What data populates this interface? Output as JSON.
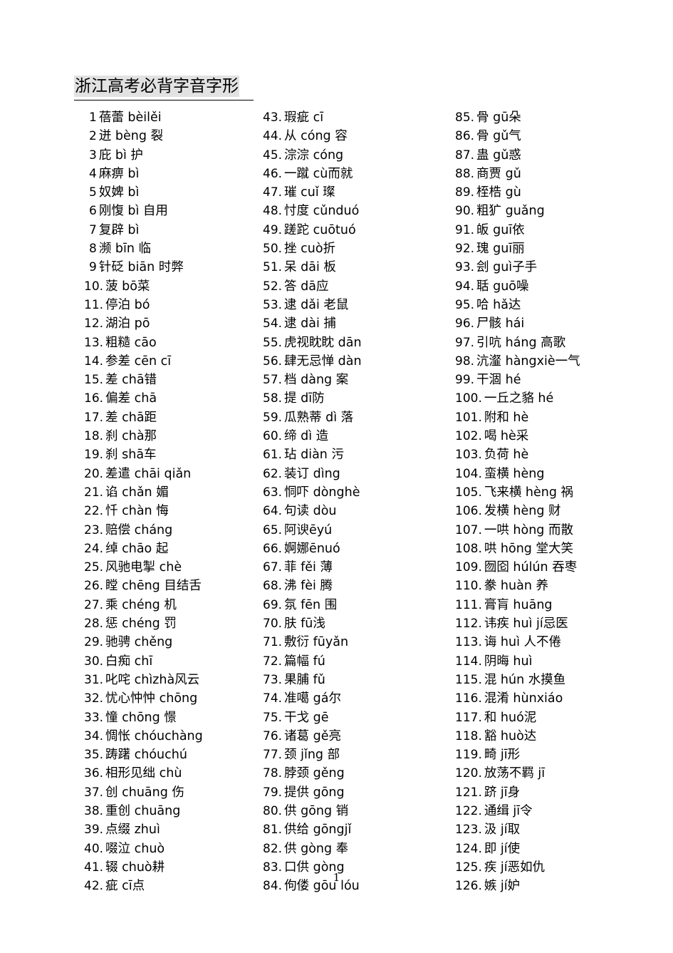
{
  "document": {
    "title": "浙江高考必背字音字形",
    "page_number": "1",
    "title_highlight_color": "#e2e2e2",
    "text_color": "#000000",
    "background_color": "#ffffff"
  },
  "columns": [
    {
      "id": "column-1",
      "entries": [
        {
          "num": "1",
          "text": "蓓蕾 bèilěi"
        },
        {
          "num": "2",
          "text": "迸 bèng 裂"
        },
        {
          "num": "3",
          "text": "庇 bì 护"
        },
        {
          "num": "4",
          "text": "麻痹 bì"
        },
        {
          "num": "5",
          "text": "奴婢 bì"
        },
        {
          "num": "6",
          "text": "刚愎 bì 自用"
        },
        {
          "num": "7",
          "text": "复辟 bì"
        },
        {
          "num": "8",
          "text": "濒 bīn 临"
        },
        {
          "num": "9",
          "text": "针砭 biān 时弊"
        },
        {
          "num": "10.",
          "text": "菠 bō菜"
        },
        {
          "num": "11.",
          "text": "停泊 bó"
        },
        {
          "num": "12.",
          "text": "湖泊 pō"
        },
        {
          "num": "13.",
          "text": "粗糙 cāo"
        },
        {
          "num": "14.",
          "text": "参差 cēn cī"
        },
        {
          "num": "15.",
          "text": "差 chā错"
        },
        {
          "num": "16.",
          "text": "偏差 chā"
        },
        {
          "num": "17.",
          "text": "差 chā距"
        },
        {
          "num": "18.",
          "text": "刹 chà那"
        },
        {
          "num": "19.",
          "text": "刹 shā车"
        },
        {
          "num": "20.",
          "text": "差遣 chāi qiǎn"
        },
        {
          "num": "21.",
          "text": "谄 chǎn 媚"
        },
        {
          "num": "22.",
          "text": "忏 chàn 悔"
        },
        {
          "num": "23.",
          "text": "赔偿 cháng"
        },
        {
          "num": "24.",
          "text": "绰 chāo 起"
        },
        {
          "num": "25.",
          "text": "风驰电掣 chè"
        },
        {
          "num": "26.",
          "text": "瞠 chēng 目结舌"
        },
        {
          "num": "27.",
          "text": "乘 chéng 机"
        },
        {
          "num": "28.",
          "text": "惩 chéng 罚"
        },
        {
          "num": "29.",
          "text": "驰骋 chěng"
        },
        {
          "num": "30.",
          "text": "白痴 chī"
        },
        {
          "num": "31.",
          "text": "叱咤 chìzhà风云"
        },
        {
          "num": "32.",
          "text": "忧心忡忡 chōng"
        },
        {
          "num": "33.",
          "text": "憧 chōng 憬"
        },
        {
          "num": "34.",
          "text": "惆怅 chóuchàng"
        },
        {
          "num": "35.",
          "text": "踌躇 chóuchú"
        },
        {
          "num": "36.",
          "text": "相形见绌 chù"
        },
        {
          "num": "37.",
          "text": "创 chuāng 伤"
        },
        {
          "num": "38.",
          "text": "重创 chuāng"
        },
        {
          "num": "39.",
          "text": "点缀 zhuì"
        },
        {
          "num": "40.",
          "text": "啜泣 chuò"
        },
        {
          "num": "41.",
          "text": "辍 chuò耕"
        },
        {
          "num": "42.",
          "text": "疵 cī点"
        }
      ]
    },
    {
      "id": "column-2",
      "entries": [
        {
          "num": "43.",
          "text": "瑕疵 cī"
        },
        {
          "num": "44.",
          "text": "从 cóng 容"
        },
        {
          "num": "45.",
          "text": "淙淙 cóng"
        },
        {
          "num": "46.",
          "text": "一蹴 cù而就"
        },
        {
          "num": "47.",
          "text": "璀 cuǐ 璨"
        },
        {
          "num": "48.",
          "text": "忖度 cǔnduó"
        },
        {
          "num": "49.",
          "text": "蹉跎 cuōtuó"
        },
        {
          "num": "50.",
          "text": "挫 cuò折"
        },
        {
          "num": "51.",
          "text": "呆 dāi 板"
        },
        {
          "num": "52.",
          "text": "答 dā应"
        },
        {
          "num": "53.",
          "text": "逮 dǎi 老鼠"
        },
        {
          "num": "54.",
          "text": "逮 dài 捕"
        },
        {
          "num": "55.",
          "text": "虎视眈眈 dān"
        },
        {
          "num": "56.",
          "text": "肆无忌惮 dàn"
        },
        {
          "num": "57.",
          "text": "档 dàng 案"
        },
        {
          "num": "58.",
          "text": "提 dī防"
        },
        {
          "num": "59.",
          "text": "瓜熟蒂 dì 落"
        },
        {
          "num": "60.",
          "text": "缔 dì 造"
        },
        {
          "num": "61.",
          "text": "玷 diàn 污"
        },
        {
          "num": "62.",
          "text": "装订 dìng"
        },
        {
          "num": "63.",
          "text": "恫吓 dònghè"
        },
        {
          "num": "64.",
          "text": "句读 dòu"
        },
        {
          "num": "65.",
          "text": "阿谀ēyú"
        },
        {
          "num": "66.",
          "text": "婀娜ēnuó"
        },
        {
          "num": "67.",
          "text": "菲 fěi 薄"
        },
        {
          "num": "68.",
          "text": "沸 fèi 腾"
        },
        {
          "num": "69.",
          "text": "氛 fēn 围"
        },
        {
          "num": "70.",
          "text": "肤 fū浅"
        },
        {
          "num": "71.",
          "text": "敷衍 fūyǎn"
        },
        {
          "num": "72.",
          "text": "篇幅 fú"
        },
        {
          "num": "73.",
          "text": "果脯 fǔ"
        },
        {
          "num": "74.",
          "text": "准噶 gá尔"
        },
        {
          "num": "75.",
          "text": "干戈 gē"
        },
        {
          "num": "76.",
          "text": "诸葛 gě亮"
        },
        {
          "num": "77.",
          "text": "颈 jǐng 部"
        },
        {
          "num": "78.",
          "text": "脖颈 gěng"
        },
        {
          "num": "79.",
          "text": "提供 gōng"
        },
        {
          "num": "80.",
          "text": "供 gōng 销"
        },
        {
          "num": "81.",
          "text": "供给 gōngjǐ"
        },
        {
          "num": "82.",
          "text": "供 gòng 奉"
        },
        {
          "num": "83.",
          "text": "口供 gòng"
        },
        {
          "num": "84.",
          "text": "佝偻 gōu lóu"
        }
      ]
    },
    {
      "id": "column-3",
      "entries": [
        {
          "num": "85.",
          "text": "骨 gū朵"
        },
        {
          "num": "86.",
          "text": "骨 gǔ气"
        },
        {
          "num": "87.",
          "text": "蛊 gǔ惑"
        },
        {
          "num": "88.",
          "text": "商贾 gǔ"
        },
        {
          "num": "89.",
          "text": "桎梏 gù"
        },
        {
          "num": "90.",
          "text": "粗犷 guǎng"
        },
        {
          "num": "91.",
          "text": "皈 guī依"
        },
        {
          "num": "92.",
          "text": "瑰 guī丽"
        },
        {
          "num": "93.",
          "text": "刽 guì子手"
        },
        {
          "num": "94.",
          "text": "聒 guō噪"
        },
        {
          "num": "95.",
          "text": "哈 hǎ达"
        },
        {
          "num": "96.",
          "text": "尸骸 hái"
        },
        {
          "num": "97.",
          "text": "引吭 háng 高歌"
        },
        {
          "num": "98.",
          "text": "沆瀣 hàngxiè一气"
        },
        {
          "num": "99.",
          "text": "干涸 hé"
        },
        {
          "num": "100.",
          "text": "一丘之貉 hé"
        },
        {
          "num": "101.",
          "text": "附和 hè"
        },
        {
          "num": "102.",
          "text": "喝 hè采"
        },
        {
          "num": "103.",
          "text": "负荷 hè"
        },
        {
          "num": "104.",
          "text": "蛮横 hèng"
        },
        {
          "num": "105.",
          "text": "飞来横 hèng 祸"
        },
        {
          "num": "106.",
          "text": "发横 hèng 财"
        },
        {
          "num": "107.",
          "text": "一哄 hòng 而散"
        },
        {
          "num": "108.",
          "text": "哄 hōng 堂大笑"
        },
        {
          "num": "109.",
          "text": "囫囵 húlún 吞枣"
        },
        {
          "num": "110.",
          "text": "豢 huàn 养"
        },
        {
          "num": "111.",
          "text": "膏肓 huāng"
        },
        {
          "num": "112.",
          "text": "讳疾 huì jí忌医"
        },
        {
          "num": "113.",
          "text": "诲 huì 人不倦"
        },
        {
          "num": "114.",
          "text": "阴晦 huì"
        },
        {
          "num": "115.",
          "text": "混 hún 水摸鱼"
        },
        {
          "num": "116.",
          "text": "混淆 hùnxiáo"
        },
        {
          "num": "117.",
          "text": "和 huó泥"
        },
        {
          "num": "118.",
          "text": "豁 huò达"
        },
        {
          "num": "119.",
          "text": "畸 jī形"
        },
        {
          "num": "120.",
          "text": "放荡不羁 jī"
        },
        {
          "num": "121.",
          "text": "跻 jī身"
        },
        {
          "num": "122.",
          "text": "通缉 jī令"
        },
        {
          "num": "123.",
          "text": "汲 jí取"
        },
        {
          "num": "124.",
          "text": "即 jí使"
        },
        {
          "num": "125.",
          "text": "疾 jí恶如仇"
        },
        {
          "num": "126.",
          "text": "嫉 jí妒"
        }
      ]
    }
  ]
}
